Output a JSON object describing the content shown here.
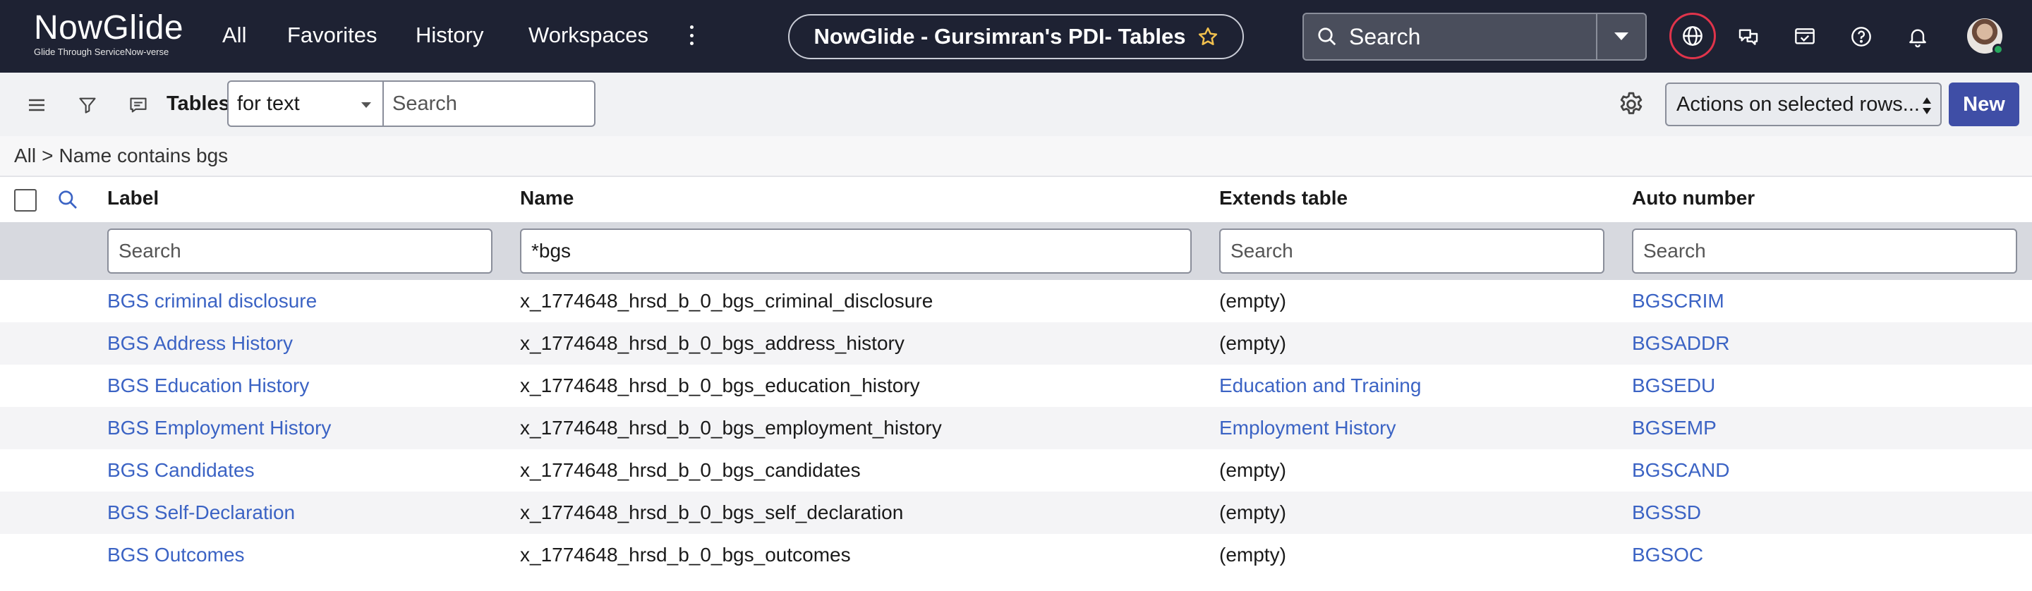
{
  "brand": {
    "name": "NowGlide",
    "tagline": "Glide Through ServiceNow-verse"
  },
  "nav": {
    "all": "All",
    "favorites": "Favorites",
    "history": "History",
    "workspaces": "Workspaces"
  },
  "page_title": "NowGlide - Gursimran's PDI- Tables",
  "global_search": {
    "placeholder": "Search"
  },
  "header_icons": [
    "globe-icon",
    "chat-icon",
    "workspace-icon",
    "help-icon",
    "bell-icon",
    "avatar"
  ],
  "toolbar": {
    "title": "Tables",
    "search_field": "for text",
    "search_placeholder": "Search",
    "actions_label": "Actions on selected rows...",
    "new_label": "New"
  },
  "breadcrumb": {
    "all": "All",
    "separator": ">",
    "condition": "Name contains bgs"
  },
  "columns": {
    "label": "Label",
    "name": "Name",
    "extends": "Extends table",
    "auto_number": "Auto number"
  },
  "filters": {
    "label": "",
    "name": "*bgs",
    "extends": "",
    "auto_number": "",
    "placeholder": "Search"
  },
  "rows": [
    {
      "label": "BGS criminal disclosure",
      "name": "x_1774648_hrsd_b_0_bgs_criminal_disclosure",
      "extends": "(empty)",
      "extends_link": false,
      "auto_number": "BGSCRIM"
    },
    {
      "label": "BGS Address History",
      "name": "x_1774648_hrsd_b_0_bgs_address_history",
      "extends": "(empty)",
      "extends_link": false,
      "auto_number": "BGSADDR"
    },
    {
      "label": "BGS Education History",
      "name": "x_1774648_hrsd_b_0_bgs_education_history",
      "extends": "Education and Training",
      "extends_link": true,
      "auto_number": "BGSEDU"
    },
    {
      "label": "BGS Employment History",
      "name": "x_1774648_hrsd_b_0_bgs_employment_history",
      "extends": "Employment History",
      "extends_link": true,
      "auto_number": "BGSEMP"
    },
    {
      "label": "BGS Candidates",
      "name": "x_1774648_hrsd_b_0_bgs_candidates",
      "extends": "(empty)",
      "extends_link": false,
      "auto_number": "BGSCAND"
    },
    {
      "label": "BGS Self-Declaration",
      "name": "x_1774648_hrsd_b_0_bgs_self_declaration",
      "extends": "(empty)",
      "extends_link": false,
      "auto_number": "BGSSD"
    },
    {
      "label": "BGS Outcomes",
      "name": "x_1774648_hrsd_b_0_bgs_outcomes",
      "extends": "(empty)",
      "extends_link": false,
      "auto_number": "BGSOC"
    }
  ],
  "colors": {
    "nav_bg": "#1e2233",
    "link": "#3b63c4",
    "primary_button": "#3f4ea6",
    "alert_ring": "#e0344b"
  }
}
